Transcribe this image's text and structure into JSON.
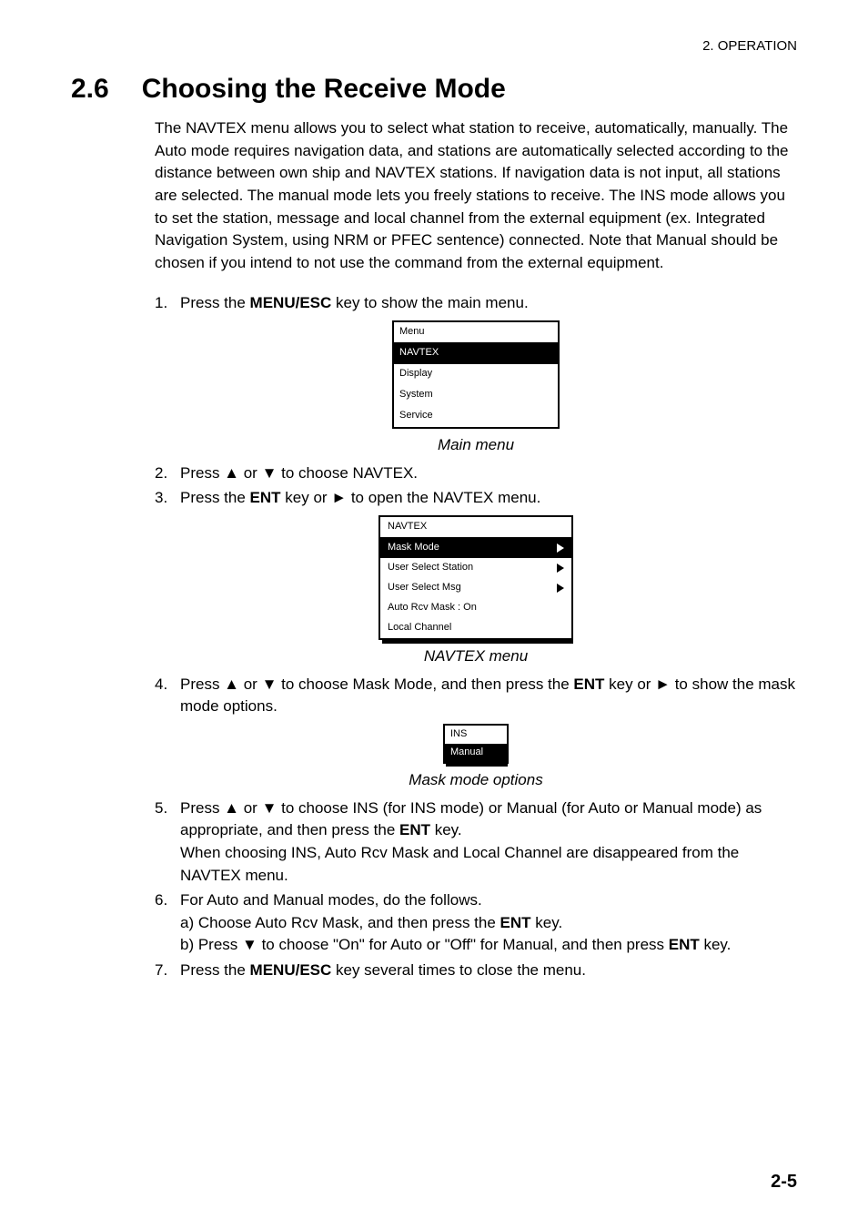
{
  "header": {
    "running": "2. OPERATION"
  },
  "section": {
    "num": "2.6",
    "title": "Choosing the Receive Mode"
  },
  "intro": "The NAVTEX menu allows you to select what station to receive, automatically, manually. The Auto mode requires navigation data, and stations are automatically selected according to the distance between own ship and NAVTEX stations. If navigation data is not input, all stations are selected. The manual mode lets you freely stations to receive. The INS mode allows you to set the station, message and local channel from the external equipment (ex. Integrated Navigation System, using NRM or PFEC sentence) connected. Note that Manual should be chosen if you intend to not use the command from the external equipment.",
  "steps": {
    "s1a": "Press the ",
    "s1b": "MENU/ESC",
    "s1c": " key to show the main menu.",
    "s2": "Press ▲ or ▼ to choose NAVTEX.",
    "s3a": "Press the ",
    "s3b": "ENT",
    "s3c": " key or ► to open the NAVTEX menu.",
    "s4a": "Press ▲ or ▼ to choose Mask Mode, and then press the ",
    "s4b": "ENT",
    "s4c": " key or ► to show the mask mode options.",
    "s5a": "Press ▲ or ▼ to choose INS (for INS mode) or Manual (for Auto or Manual mode) as appropriate, and then press the ",
    "s5b": "ENT",
    "s5c": " key.",
    "s5d": "When choosing INS, Auto Rcv Mask and Local Channel are disappeared from the NAVTEX menu.",
    "s6a": "For Auto and Manual modes, do the follows.",
    "s6b1": "a) Choose Auto Rcv Mask, and then press the ",
    "s6b2": "ENT",
    "s6b3": " key.",
    "s6c1": "b) Press ▼ to choose \"On\" for Auto or \"Off\" for Manual, and then press ",
    "s6c2": "ENT",
    "s6c3": " key.",
    "s7a": "Press the ",
    "s7b": "MENU/ESC",
    "s7c": " key several times to close the menu."
  },
  "captions": {
    "main": "Main menu",
    "navtex": "NAVTEX menu",
    "mask": "Mask mode options"
  },
  "mainmenu": {
    "title": "Menu",
    "items": [
      "NAVTEX",
      "Display",
      "System",
      "Service"
    ]
  },
  "navtexmenu": {
    "title": "NAVTEX",
    "items": [
      {
        "label": "Mask Mode",
        "arrow": true,
        "hl": true
      },
      {
        "label": "User Select Station",
        "arrow": true,
        "hl": false
      },
      {
        "label": "User Select Msg",
        "arrow": true,
        "hl": false
      },
      {
        "label": "Auto Rcv Mask : On",
        "arrow": false,
        "hl": false
      },
      {
        "label": "Local Channel",
        "arrow": false,
        "hl": false
      }
    ]
  },
  "maskbox": {
    "items": [
      "INS",
      "Manual"
    ]
  },
  "footer": {
    "page": "2-5"
  }
}
